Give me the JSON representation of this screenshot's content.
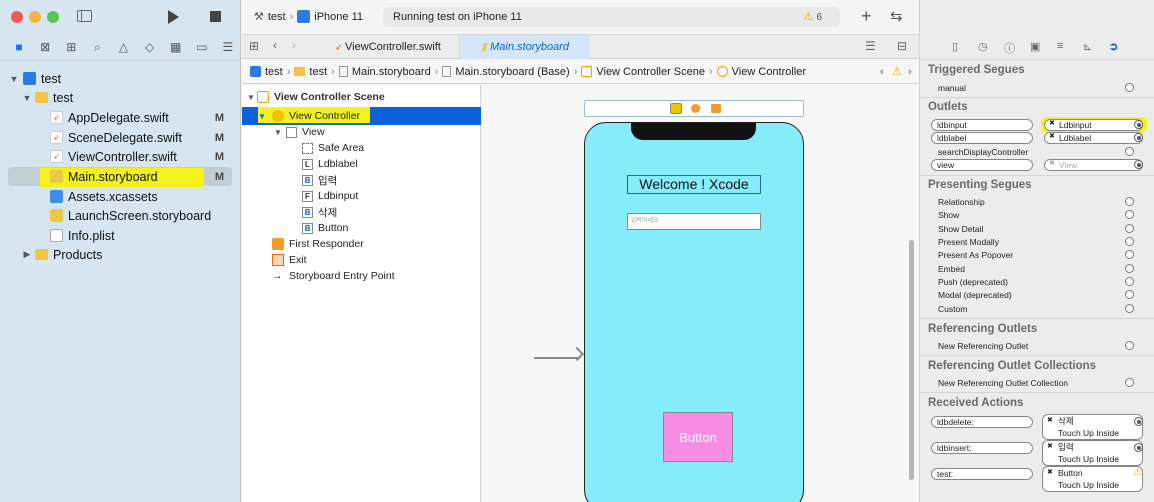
{
  "scheme": {
    "name": "test",
    "device": "iPhone 11",
    "status": "Running test on iPhone 11",
    "warnings": "6"
  },
  "navigator": {
    "items": [
      {
        "label": "test",
        "flag": ""
      },
      {
        "label": "test",
        "flag": ""
      },
      {
        "label": "AppDelegate.swift",
        "flag": "M"
      },
      {
        "label": "SceneDelegate.swift",
        "flag": "M"
      },
      {
        "label": "ViewController.swift",
        "flag": "M"
      },
      {
        "label": "Main.storyboard",
        "flag": "M"
      },
      {
        "label": "Assets.xcassets",
        "flag": ""
      },
      {
        "label": "LaunchScreen.storyboard",
        "flag": ""
      },
      {
        "label": "Info.plist",
        "flag": ""
      },
      {
        "label": "Products",
        "flag": ""
      }
    ]
  },
  "tabs": [
    {
      "label": "ViewController.swift"
    },
    {
      "label": "Main.storyboard"
    }
  ],
  "jumpbar": [
    "test",
    "test",
    "Main.storyboard",
    "Main.storyboard (Base)",
    "View Controller Scene",
    "View Controller"
  ],
  "outline": {
    "rows": [
      {
        "label": "View Controller Scene",
        "icon": ""
      },
      {
        "label": "View Controller",
        "icon": ""
      },
      {
        "label": "View",
        "icon": ""
      },
      {
        "label": "Safe Area",
        "icon": ""
      },
      {
        "label": "Ldblabel",
        "icon": "L"
      },
      {
        "label": "입력",
        "icon": "B"
      },
      {
        "label": "Ldbinput",
        "icon": "F"
      },
      {
        "label": "삭제",
        "icon": "B"
      },
      {
        "label": "Button",
        "icon": "B"
      },
      {
        "label": "First Responder",
        "icon": ""
      },
      {
        "label": "Exit",
        "icon": ""
      },
      {
        "label": "Storyboard Entry Point",
        "icon": ""
      }
    ]
  },
  "canvas": {
    "welcome_label": "Welcome ! Xcode",
    "textfield_placeholder": "입력하세요",
    "button_label": "Button"
  },
  "inspector": {
    "triggered_segues": {
      "title": "Triggered Segues",
      "items": [
        "manual"
      ]
    },
    "outlets": {
      "title": "Outlets",
      "items": [
        {
          "name": "ldbinput",
          "target": "Ldbinput"
        },
        {
          "name": "ldblabel",
          "target": "Ldblabel"
        },
        {
          "name": "searchDisplayController",
          "target": ""
        },
        {
          "name": "view",
          "target": "View"
        }
      ]
    },
    "presenting_segues": {
      "title": "Presenting Segues",
      "items": [
        "Relationship",
        "Show",
        "Show Detail",
        "Present Modally",
        "Present As Popover",
        "Embed",
        "Push (deprecated)",
        "Modal (deprecated)",
        "Custom"
      ]
    },
    "referencing_outlets": {
      "title": "Referencing Outlets",
      "items": [
        "New Referencing Outlet"
      ]
    },
    "referencing_outlet_collections": {
      "title": "Referencing Outlet Collections",
      "items": [
        "New Referencing Outlet Collection"
      ]
    },
    "received_actions": {
      "title": "Received Actions",
      "items": [
        {
          "name": "ldbdelete:",
          "target": "삭제",
          "event": "Touch Up Inside"
        },
        {
          "name": "ldbinsert:",
          "target": "입력",
          "event": "Touch Up Inside"
        },
        {
          "name": "test:",
          "target": "Button",
          "event": "Touch Up Inside"
        }
      ]
    }
  },
  "colors": {
    "highlight": "#f4f21a",
    "selection": "#0a63d8",
    "canvas_view": "#84ecfb",
    "button_bg": "#f98de6"
  }
}
